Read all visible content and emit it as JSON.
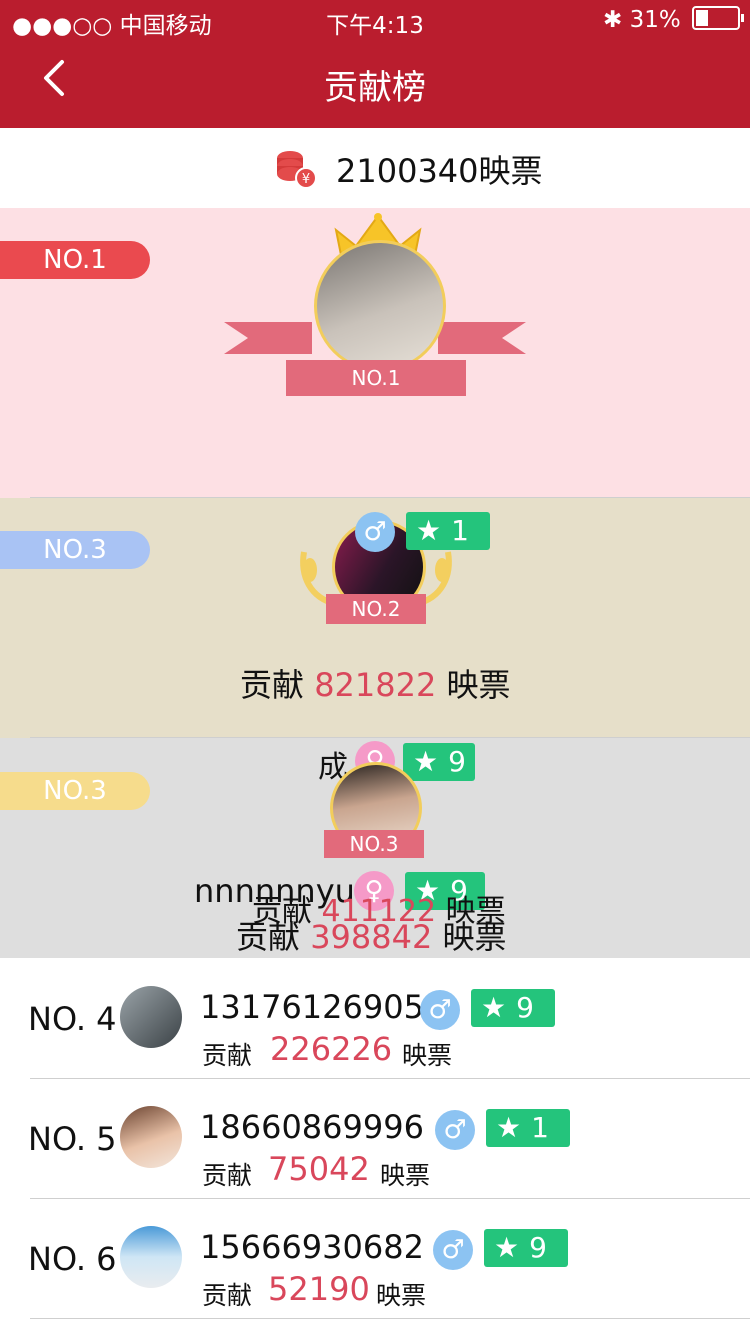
{
  "status": {
    "carrier": "●●●○○ 中国移动",
    "time": "下午4:13",
    "battery": "31%"
  },
  "nav": {
    "title": "贡献榜"
  },
  "total": {
    "value": "2100340映票"
  },
  "podium": {
    "first": {
      "pill": "NO.1",
      "ribbon": "NO.1"
    },
    "second": {
      "pill": "NO.3",
      "ribbon": "NO.2",
      "level": "1",
      "contribution_label": "贡献",
      "contribution_value": "821822",
      "unit": "映票"
    },
    "third": {
      "pill": "NO.3",
      "ribbon": "NO.3",
      "name": "成",
      "level": "9",
      "overlay_name": "nnnnnnyu",
      "overlay_label": "贡献",
      "overlay_value": "411122",
      "overlay_unit": "映票",
      "overlay_level": "9",
      "contribution_label": "贡献",
      "contribution_value": "398842",
      "unit": "映票"
    }
  },
  "rows": [
    {
      "rank": "NO. 4",
      "name": "13176126905",
      "gender": "male",
      "level": "9",
      "label": "贡献",
      "value": "226226",
      "unit": "映票"
    },
    {
      "rank": "NO. 5",
      "name": "18660869996",
      "gender": "male",
      "level": "1",
      "label": "贡献",
      "value": "75042",
      "unit": "映票"
    },
    {
      "rank": "NO. 6",
      "name": "15666930682",
      "gender": "male",
      "level": "9",
      "label": "贡献",
      "value": "52190",
      "unit": "映票"
    }
  ],
  "colors": {
    "brand_red": "#ba1d2e",
    "value_red": "#d9475b",
    "level_green": "#24c47c"
  }
}
